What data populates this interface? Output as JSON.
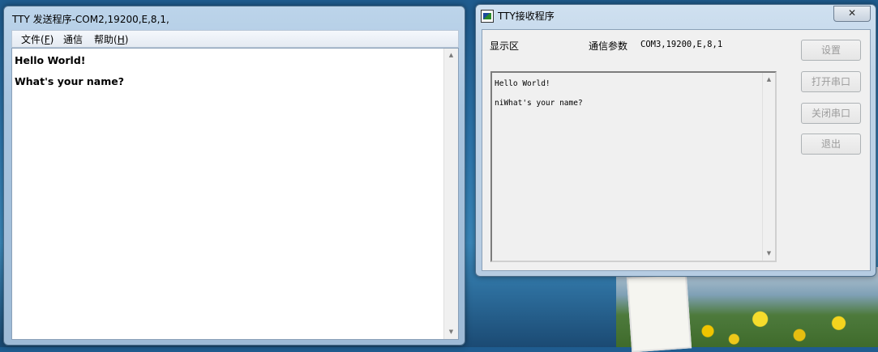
{
  "sender_window": {
    "title": "TTY 发送程序-COM2,19200,E,8,1,",
    "menu": [
      {
        "label": "文件(",
        "key": "F",
        "suffix": ")"
      },
      {
        "label": "通信",
        "key": "",
        "suffix": ""
      },
      {
        "label": "帮助(",
        "key": "H",
        "suffix": ")"
      }
    ],
    "editor_lines": [
      "Hello World!",
      "What's your name?"
    ]
  },
  "receiver_window": {
    "title": "TTY接收程序",
    "close_label": "✕",
    "display_label": "显示区",
    "params_label": "通信参数",
    "params_value": "COM3,19200,E,8,1",
    "display_lines": [
      "Hello World!",
      "niWhat's your name?"
    ],
    "buttons": {
      "settings": "设置",
      "open_port": "打开串口",
      "close_port": "关闭串口",
      "exit": "退出"
    }
  },
  "colors": {
    "button_disabled_text": "#9b9b9b",
    "desktop": "#2e78b0"
  }
}
